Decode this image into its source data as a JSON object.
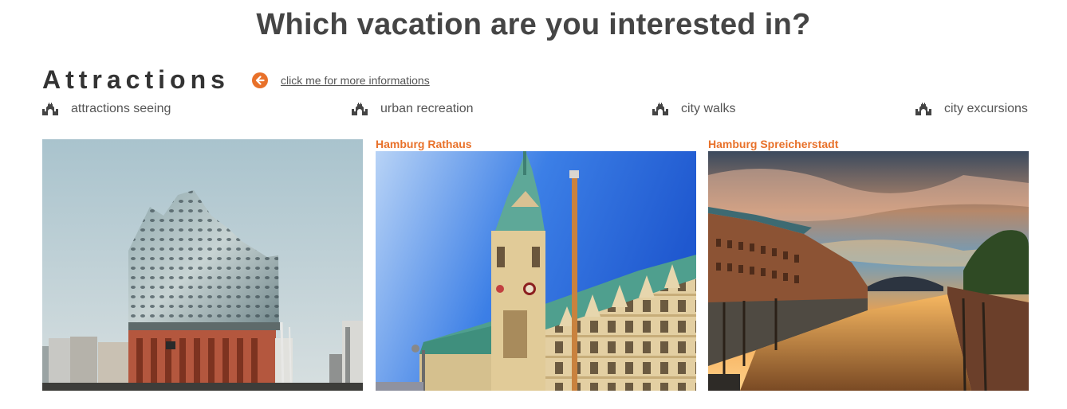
{
  "page": {
    "title": "Which vacation are you interested in?"
  },
  "section": {
    "title": "Attractions",
    "info_link": "click me for more informations"
  },
  "categories": [
    {
      "label": "attractions seeing",
      "icon": "castle-icon"
    },
    {
      "label": "urban recreation",
      "icon": "castle-icon"
    },
    {
      "label": "city walks",
      "icon": "castle-icon"
    },
    {
      "label": "city excursions",
      "icon": "castle-icon"
    }
  ],
  "cards": [
    {
      "title": "",
      "image": "elbphilharmonie-photo"
    },
    {
      "title": "Hamburg Rathaus",
      "image": "rathaus-photo"
    },
    {
      "title": "Hamburg Spreicherstadt",
      "image": "speicherstadt-photo"
    }
  ],
  "colors": {
    "accent": "#e8712a",
    "text": "#454545"
  }
}
